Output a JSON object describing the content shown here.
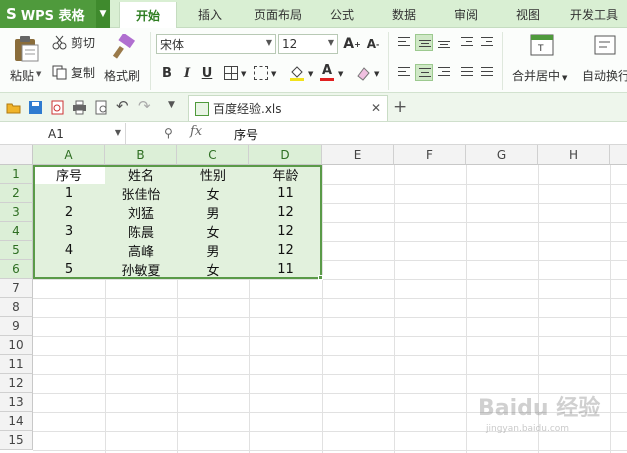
{
  "app": {
    "name": "WPS 表格"
  },
  "ribbon_tabs": [
    "开始",
    "插入",
    "页面布局",
    "公式",
    "数据",
    "审阅",
    "视图",
    "开发工具"
  ],
  "active_tab": "开始",
  "clipboard": {
    "paste": "粘贴",
    "cut": "剪切",
    "copy": "复制",
    "format_painter": "格式刷"
  },
  "font": {
    "name": "宋体",
    "size": "12"
  },
  "merge_center": "合并居中",
  "wrap_text": "自动换行",
  "document": {
    "tab_name": "百度经验.xls"
  },
  "formula_bar": {
    "cell_ref": "A1",
    "fx": "fx",
    "content": "序号"
  },
  "columns": [
    "A",
    "B",
    "C",
    "D",
    "E",
    "F",
    "G",
    "H"
  ],
  "rows": [
    "1",
    "2",
    "3",
    "4",
    "5",
    "6",
    "7",
    "8",
    "9",
    "10",
    "11",
    "12",
    "13",
    "14",
    "15"
  ],
  "table": {
    "headers": [
      "序号",
      "姓名",
      "性别",
      "年龄"
    ],
    "rows": [
      [
        "1",
        "张佳怡",
        "女",
        "11"
      ],
      [
        "2",
        "刘猛",
        "男",
        "12"
      ],
      [
        "3",
        "陈晨",
        "女",
        "12"
      ],
      [
        "4",
        "高峰",
        "男",
        "12"
      ],
      [
        "5",
        "孙敏夏",
        "女",
        "11"
      ]
    ]
  },
  "colors": {
    "accent": "#4f9a3c",
    "selection_fill": "#e2f1dd",
    "selection_border": "#5a9a48"
  },
  "watermark": {
    "text": "Baidu 经验",
    "sub": "jingyan.baidu.com"
  }
}
